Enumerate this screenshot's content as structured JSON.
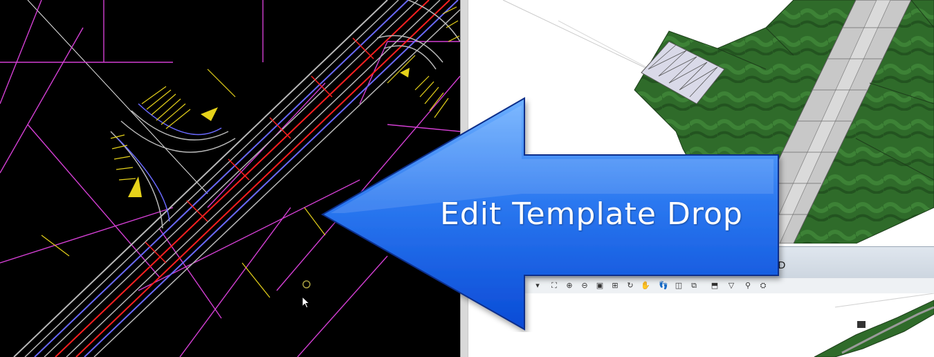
{
  "callout": {
    "text": "Edit Template Drop",
    "fill_top": "#4f9bff",
    "fill_bottom": "#0a4bd6",
    "stroke": "#0a2f8a"
  },
  "view_3d": {
    "window_title_partial": "t-3D",
    "toolbar_icons": [
      "dropdown-icon",
      "place-icon",
      "zoom-in-icon",
      "zoom-out-icon",
      "window-area-icon",
      "fit-view-icon",
      "rotate-view-icon",
      "pan-view-icon",
      "walk-icon",
      "camera-icon",
      "copy-view-icon",
      "clip-volume-icon",
      "clip-mask-icon",
      "view-attributes-icon",
      "render-icon"
    ]
  },
  "view_2d": {
    "background": "#000000"
  },
  "colors": {
    "cad_magenta": "#d43fd4",
    "cad_red": "#ff2020",
    "cad_yellow": "#e6d21a",
    "cad_blue": "#6a6aff",
    "cad_gray": "#b9b9b9",
    "terrain_green": "#2f6b2a"
  }
}
